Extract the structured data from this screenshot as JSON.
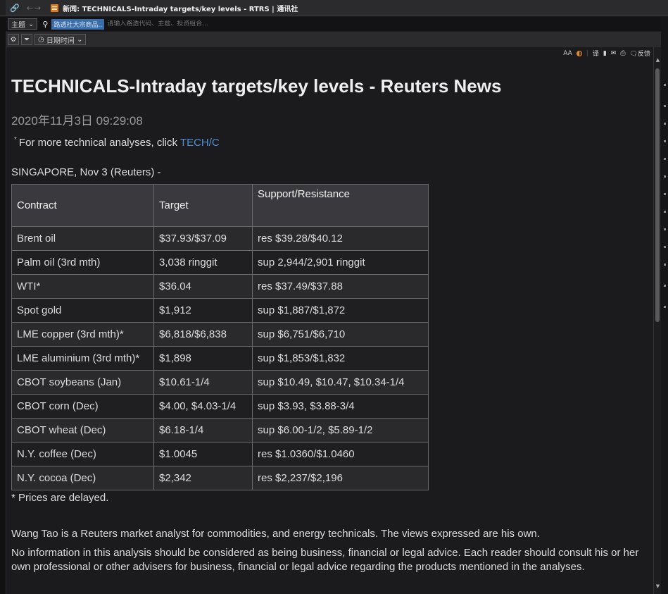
{
  "window": {
    "title": "新闻: TECHNICALS-Intraday targets/key levels - RTRS | 通讯社"
  },
  "searchbar": {
    "topic_label": "主题",
    "chip": "路透社大宗商品..",
    "placeholder": "请输入路透代码、主题、投资组合..."
  },
  "filterbar": {
    "date_label": "日期时间"
  },
  "toolbar": {
    "font_size": "AA",
    "feedback_label": "反馈"
  },
  "article": {
    "headline": "TECHNICALS-Intraday targets/key levels - Reuters News",
    "datetime": "2020年11月3日 09:29:08",
    "more_prefix": "For more technical analyses, click",
    "more_link": "TECH/C",
    "dateline": "SINGAPORE, Nov 3 (Reuters) -",
    "table": {
      "headers": [
        "Contract",
        "Target",
        "Support/Resistance"
      ],
      "rows": [
        [
          "Brent oil",
          "$37.93/$37.09",
          "res $39.28/$40.12"
        ],
        [
          "Palm oil (3rd mth)",
          "3,038 ringgit",
          "sup 2,944/2,901 ringgit"
        ],
        [
          "WTI*",
          "$36.04",
          "res $37.49/$37.88"
        ],
        [
          "Spot gold",
          "$1,912",
          "sup $1,887/$1,872"
        ],
        [
          "LME copper (3rd mth)*",
          "$6,818/$6,838",
          "sup $6,751/$6,710"
        ],
        [
          "LME aluminium (3rd mth)*",
          "$1,898",
          "sup $1,853/$1,832"
        ],
        [
          "CBOT soybeans (Jan)",
          "$10.61-1/4",
          "sup $10.49, $10.47, $10.34-1/4"
        ],
        [
          "CBOT corn (Dec)",
          "$4.00, $4.03-1/4",
          "sup $3.93, $3.88-3/4"
        ],
        [
          "CBOT wheat (Dec)",
          "$6.18-1/4",
          "sup $6.00-1/2, $5.89-1/2"
        ],
        [
          "N.Y. coffee (Dec)",
          "$1.0045",
          "res $1.0360/$1.0460"
        ],
        [
          "N.Y. cocoa (Dec)",
          "$2,342",
          "res $2,237/$2,196"
        ]
      ]
    },
    "note": "* Prices are delayed.",
    "para1": "Wang Tao is a Reuters market analyst for commodities, and energy technicals. The views expressed are his own.",
    "para2": "No information in this analysis should be considered as being business, financial or legal advice. Each reader should consult his or her own professional or other advisers for business, financial or legal advice regarding the products mentioned in the analyses."
  }
}
